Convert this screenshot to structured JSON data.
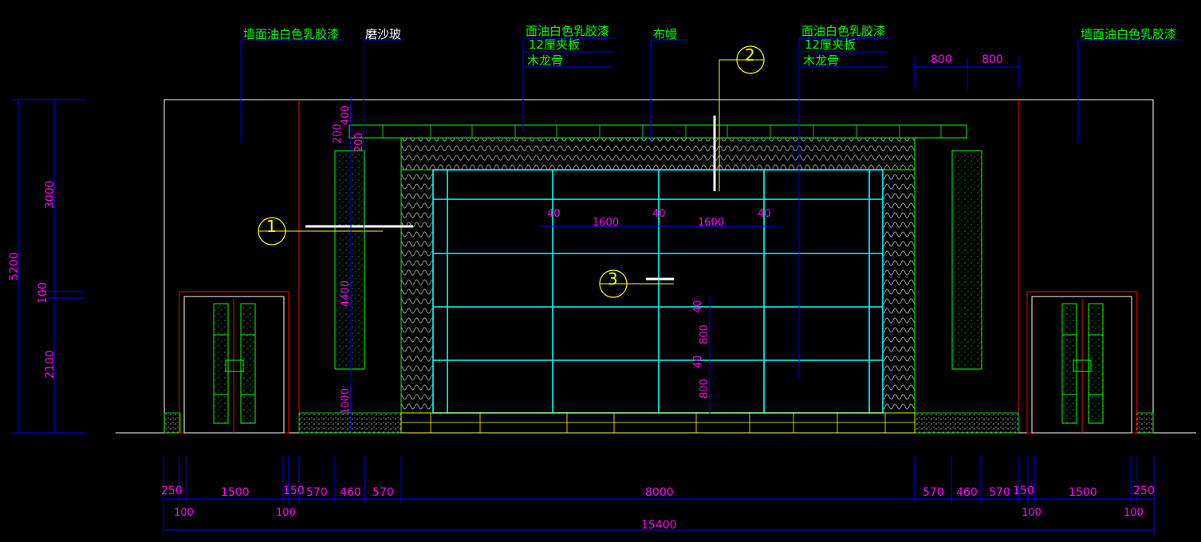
{
  "labels": {
    "wall_left": "墙面油白色乳胶漆",
    "frosted_glass": "磨沙玻",
    "paint_center": "面油白色乳胶漆",
    "plywood_center": "12厘夹板",
    "keel_center": "木龙骨",
    "curtain": "布幔",
    "paint_right": "面油白色乳胶漆",
    "plywood_right": "12厘夹板",
    "keel_right": "木龙骨",
    "wall_right": "墙面油白色乳胶漆"
  },
  "bubbles": {
    "b1": "1",
    "b2": "2",
    "b3": "3"
  },
  "dims_top": {
    "d800a": "800",
    "d800b": "800"
  },
  "dims_left": {
    "total": "5200",
    "upper": "3000",
    "gap": "100",
    "lower": "2100"
  },
  "dims_inner_left": {
    "v400": "400",
    "v200a": "200",
    "v200b": "200",
    "v4400": "4400",
    "v1000": "1000"
  },
  "dims_center": {
    "g40a": "40",
    "w1600a": "1600",
    "g40b": "40",
    "w1600b": "1600",
    "g40c": "40",
    "v40a": "40",
    "v800a": "800",
    "v40b": "40",
    "v800b": "800"
  },
  "dims_bottom": {
    "l250": "250",
    "l100a": "100",
    "l1500": "1500",
    "l100b": "100",
    "l150": "150",
    "l570a": "570",
    "l460": "460",
    "l570b": "570",
    "c8000": "8000",
    "r570a": "570",
    "r460": "460",
    "r570b": "570",
    "r150": "150",
    "r100a": "100",
    "r1500": "1500",
    "r100b": "100",
    "r250": "250",
    "total": "15400"
  },
  "colors": {
    "background": "#000000",
    "text": "#00ff00",
    "dimension": "#ff00ff",
    "leader": "#0000ff",
    "grid": "#00ffff",
    "outline": "#ffffff",
    "accent": "#ff0000"
  }
}
